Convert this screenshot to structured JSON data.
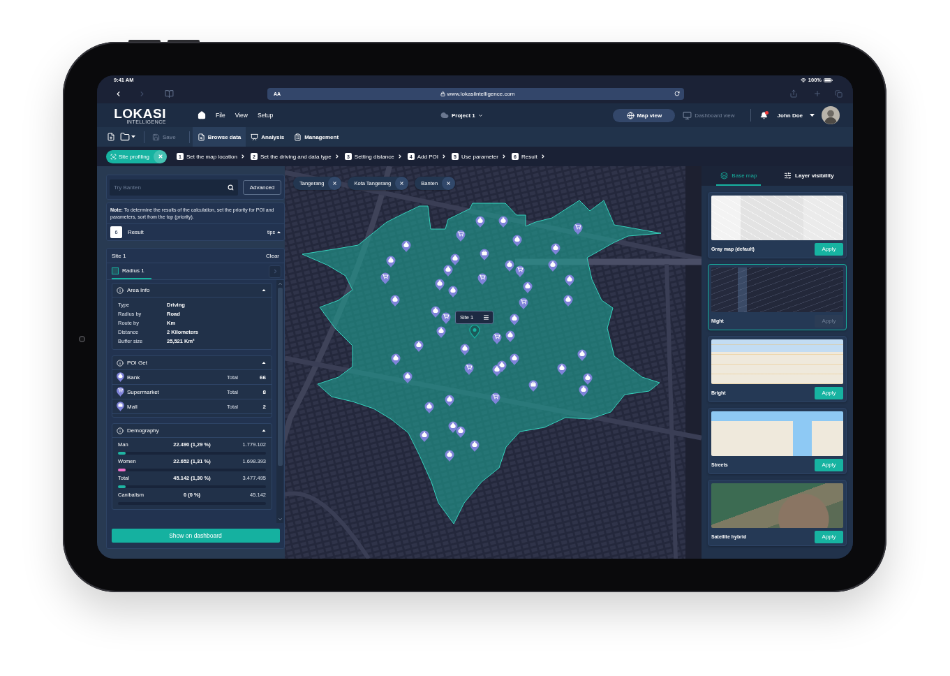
{
  "status_bar": {
    "time": "9:41 AM",
    "battery": "100%"
  },
  "browser": {
    "reader_button": "AA",
    "url": "www.lokasiintelligence.com",
    "forward_disabled": true
  },
  "header": {
    "logo": "LOKASI",
    "logo_tagline": "INTELLIGENCE",
    "menu": [
      "File",
      "View",
      "Setup"
    ],
    "project": "Project 1",
    "views": [
      {
        "label": "Map view",
        "kind": "map",
        "selected": true
      },
      {
        "label": "Dashboard view",
        "kind": "dashboard",
        "selected": false
      }
    ],
    "unread_notifications": true,
    "user": "John Doe"
  },
  "toolbar": {
    "save": {
      "label": "Save",
      "disabled": true
    },
    "items": [
      {
        "label": "Browse data",
        "kind": "browse",
        "selected": true
      },
      {
        "label": "Analysis",
        "kind": "analysis",
        "selected": false
      },
      {
        "label": "Management",
        "kind": "management",
        "selected": false
      }
    ]
  },
  "steps_bar": {
    "mode": "Site profiling",
    "steps": [
      {
        "number": "1",
        "label": "Set the map location"
      },
      {
        "number": "2",
        "label": "Set the driving and data type"
      },
      {
        "number": "3",
        "label": "Setting distance"
      },
      {
        "number": "4",
        "label": "Add POI"
      },
      {
        "number": "5",
        "label": "Use parameter"
      },
      {
        "number": "6",
        "label": "Result"
      }
    ]
  },
  "left_panel": {
    "search": {
      "placeholder": "Try Banten"
    },
    "advanced_button": "Advanced",
    "note": "**Note:** To determine the results of the calculation, set the priority for POI and parameters, sort from the top (priority).",
    "current_step": {
      "number": "6",
      "label": "Result"
    },
    "tips": "tips",
    "site": {
      "title": "Site 1",
      "clear": "Clear",
      "tabs": [
        {
          "label": "Radius 1",
          "selected": true
        }
      ],
      "sections": [
        {
          "kind": "info",
          "title": "Area Info",
          "expanded": true,
          "rows": [
            {
              "label": "Type",
              "value": "Driving"
            },
            {
              "label": "Radius by",
              "value": "Road"
            },
            {
              "label": "Route by",
              "value": "Km"
            },
            {
              "label": "Distance",
              "value": "2 Kilometers"
            },
            {
              "label": "Buffer size",
              "value": "25,521 Km²"
            }
          ]
        },
        {
          "kind": "poi",
          "title": "POI Get",
          "expanded": true,
          "rows": [
            {
              "kind": "bank",
              "label": "Bank",
              "total_label": "Total",
              "count": "66"
            },
            {
              "kind": "supermarket",
              "label": "Supermarket",
              "total_label": "Total",
              "count": "8"
            },
            {
              "kind": "mall",
              "label": "Mall",
              "total_label": "Total",
              "count": "2"
            }
          ]
        },
        {
          "kind": "demography",
          "title": "Demography",
          "expanded": true,
          "rows": [
            {
              "label": "Man",
              "value": "22.490 (1,29 %)",
              "total": "1.779.102",
              "level": 0.05,
              "color": "#1fb5a3"
            },
            {
              "label": "Women",
              "value": "22.652 (1,31 %)",
              "total": "1.698.393",
              "level": 0.05,
              "color": "#f06fc9"
            },
            {
              "label": "Total",
              "value": "45.142 (1,30 %)",
              "total": "3.477.495",
              "level": 0.05,
              "color": "#1fb5a3"
            },
            {
              "label": "Canibalism",
              "value": "0 (0 %)",
              "total": "45.142"
            }
          ]
        }
      ],
      "dashboard_button": "Show on dashboard"
    }
  },
  "map": {
    "tags": [
      "Tangerang",
      "Kota Tangerang",
      "Banten"
    ],
    "site_label": "Site 1"
  },
  "right_panel": {
    "tabs": [
      {
        "label": "Base map",
        "kind": "base",
        "selected": true
      },
      {
        "label": "Layer visibility",
        "kind": "layers",
        "selected": false
      }
    ],
    "basemaps": [
      {
        "label": "Gray map (default)",
        "kind": "gray",
        "selected": false,
        "action": "Apply"
      },
      {
        "label": "Night",
        "kind": "night",
        "selected": true,
        "action": "Apply"
      },
      {
        "label": "Bright",
        "kind": "bright",
        "selected": false,
        "action": "Apply"
      },
      {
        "label": "Streets",
        "kind": "streets",
        "selected": false,
        "action": "Apply"
      },
      {
        "label": "Satellite hybrid",
        "kind": "satellite",
        "selected": false,
        "action": "Apply"
      }
    ]
  }
}
